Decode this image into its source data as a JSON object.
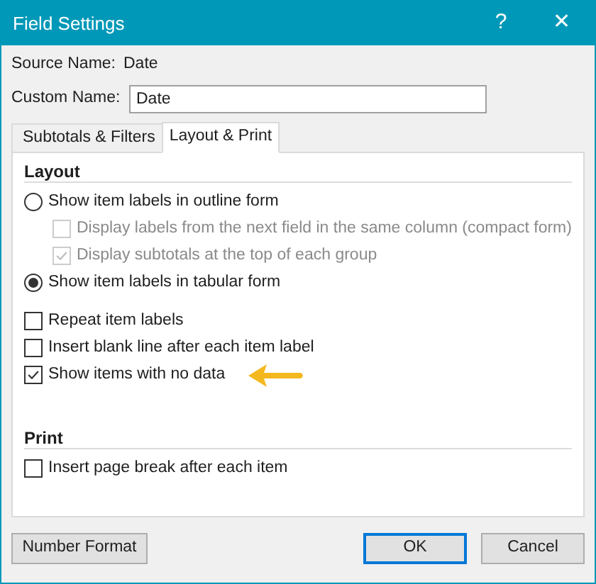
{
  "window": {
    "title": "Field Settings",
    "help": "?",
    "close": "✕"
  },
  "source_name": {
    "label": "Source Name:",
    "value": "Date"
  },
  "custom_name": {
    "label": "Custom Name:",
    "value": "Date"
  },
  "tabs": [
    {
      "label": "Subtotals & Filters",
      "selected": false
    },
    {
      "label": "Layout & Print",
      "selected": true
    }
  ],
  "layout": {
    "title": "Layout",
    "options": [
      {
        "kind": "radio",
        "label": "Show item labels in outline form",
        "selected": false,
        "children": [
          {
            "kind": "checkbox",
            "label": "Display labels from the next field in the same column (compact form)",
            "checked": false,
            "disabled": true
          },
          {
            "kind": "checkbox",
            "label": "Display subtotals at the top of each group",
            "checked": true,
            "disabled": true
          }
        ]
      },
      {
        "kind": "radio",
        "label": "Show item labels in tabular form",
        "selected": true
      },
      {
        "kind": "checkbox",
        "label": "Repeat item labels",
        "checked": false,
        "disabled": false
      },
      {
        "kind": "checkbox",
        "label": "Insert blank line after each item label",
        "checked": false,
        "disabled": false
      },
      {
        "kind": "checkbox",
        "label": "Show items with no data",
        "checked": true,
        "disabled": false,
        "highlighted": true
      }
    ]
  },
  "print": {
    "title": "Print",
    "options": [
      {
        "kind": "checkbox",
        "label": "Insert page break after each item",
        "checked": false,
        "disabled": false
      }
    ]
  },
  "buttons": [
    {
      "label": "Number Format",
      "default": false
    },
    {
      "label": "OK",
      "default": true
    },
    {
      "label": "Cancel",
      "default": false
    }
  ]
}
